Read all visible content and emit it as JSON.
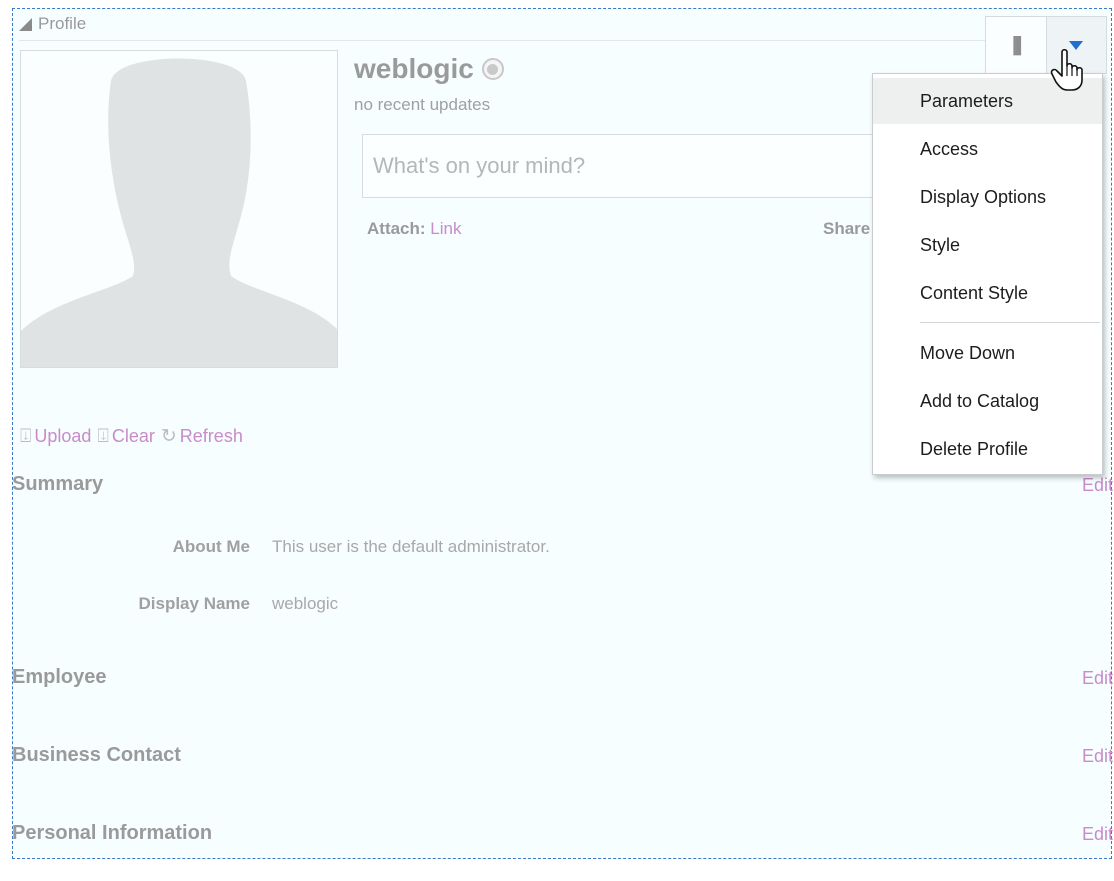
{
  "portlet": {
    "title": "Profile"
  },
  "profile": {
    "username": "weblogic",
    "recent_updates": "no recent updates",
    "status_placeholder": "What's on your mind?",
    "attach_label": "Attach:",
    "attach_link": "Link",
    "share_label": "Share"
  },
  "photo_actions": {
    "upload": "Upload",
    "clear": "Clear",
    "refresh": "Refresh"
  },
  "sections": {
    "summary": {
      "title": "Summary",
      "edit": "Edit",
      "fields": [
        {
          "label": "About Me",
          "value": "This user is the default administrator."
        },
        {
          "label": "Display Name",
          "value": "weblogic"
        }
      ]
    },
    "employee": {
      "title": "Employee",
      "edit": "Edit"
    },
    "business_contact": {
      "title": "Business Contact",
      "edit": "Edit"
    },
    "personal_information": {
      "title": "Personal Information",
      "edit": "Edit"
    }
  },
  "view_menu": {
    "items": [
      {
        "label": "Parameters",
        "highlighted": true
      },
      {
        "label": "Access"
      },
      {
        "label": "Display Options"
      },
      {
        "label": "Style"
      },
      {
        "label": "Content Style"
      },
      {
        "label": "Move Down"
      },
      {
        "label": "Add to Catalog"
      },
      {
        "label": "Delete Profile"
      }
    ]
  },
  "icons": {
    "collapse": "collapse-triangle-icon",
    "presence": "presence-status-icon",
    "upload": "upload-icon",
    "clear": "clear-icon",
    "refresh": "refresh-icon",
    "columns": "columns-icon",
    "dropdown": "caret-down-icon",
    "cursor": "hand-pointer-icon"
  },
  "colors": {
    "link": "#c98bc9",
    "frame_border": "#3a78c8",
    "panel_bg": "#f7feff",
    "caret": "#1f6fd0",
    "muted_text": "#9a9a9a"
  }
}
